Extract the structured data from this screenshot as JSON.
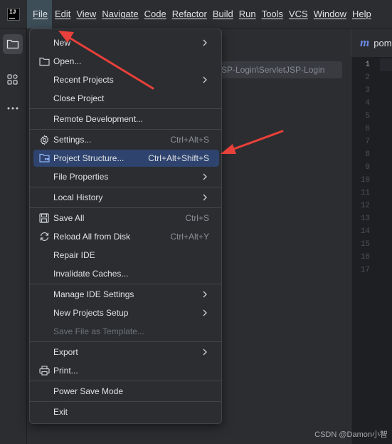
{
  "menubar": {
    "logo_text": "IJ",
    "items": [
      {
        "label": "File"
      },
      {
        "label": "Edit"
      },
      {
        "label": "View"
      },
      {
        "label": "Navigate"
      },
      {
        "label": "Code"
      },
      {
        "label": "Refactor"
      },
      {
        "label": "Build"
      },
      {
        "label": "Run"
      },
      {
        "label": "Tools"
      },
      {
        "label": "VCS"
      },
      {
        "label": "Window"
      },
      {
        "label": "Help"
      }
    ],
    "active_item": "File"
  },
  "toolstrip": {
    "icons": [
      "folder-icon",
      "structure-icon",
      "more-icon"
    ]
  },
  "project_panel": {
    "path_text": "SP-Login\\ServletJSP-Login"
  },
  "editor": {
    "tab_label": "pom",
    "tab_icon_letter": "m",
    "line_numbers": [
      "1",
      "2",
      "3",
      "4",
      "5",
      "6",
      "7",
      "8",
      "9",
      "10",
      "11",
      "12",
      "13",
      "14",
      "15",
      "16",
      "17"
    ],
    "current_line": "1"
  },
  "file_menu": {
    "items": {
      "new": {
        "label": "New"
      },
      "open": {
        "label": "Open..."
      },
      "recent_projects": {
        "label": "Recent Projects"
      },
      "close_project": {
        "label": "Close Project"
      },
      "remote_development": {
        "label": "Remote Development..."
      },
      "settings": {
        "label": "Settings...",
        "shortcut": "Ctrl+Alt+S"
      },
      "project_structure": {
        "label": "Project Structure...",
        "shortcut": "Ctrl+Alt+Shift+S"
      },
      "file_properties": {
        "label": "File Properties"
      },
      "local_history": {
        "label": "Local History"
      },
      "save_all": {
        "label": "Save All",
        "shortcut": "Ctrl+S"
      },
      "reload_all": {
        "label": "Reload All from Disk",
        "shortcut": "Ctrl+Alt+Y"
      },
      "repair_ide": {
        "label": "Repair IDE"
      },
      "invalidate_caches": {
        "label": "Invalidate Caches..."
      },
      "manage_ide_settings": {
        "label": "Manage IDE Settings"
      },
      "new_projects_setup": {
        "label": "New Projects Setup"
      },
      "save_file_as_template": {
        "label": "Save File as Template..."
      },
      "export": {
        "label": "Export"
      },
      "print": {
        "label": "Print..."
      },
      "power_save_mode": {
        "label": "Power Save Mode"
      },
      "exit": {
        "label": "Exit"
      }
    },
    "selected_item": "Project Structure..."
  },
  "annotation_color": "#e8403a",
  "watermark": "CSDN @Damon小智"
}
